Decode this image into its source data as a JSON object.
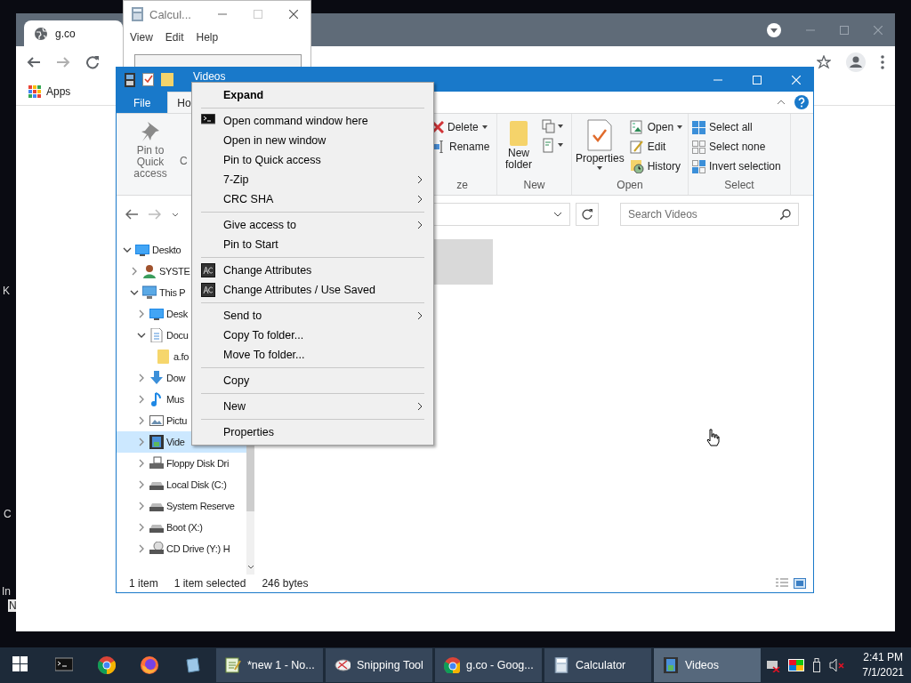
{
  "desktop": {
    "edge_texts": [
      "K",
      "C",
      "In",
      "N"
    ]
  },
  "browser": {
    "tab_title": "g.co",
    "bookmarks": [
      {
        "label": "Apps"
      }
    ]
  },
  "calculator": {
    "title": "Calcul...",
    "menu": [
      "View",
      "Edit",
      "Help"
    ]
  },
  "explorer": {
    "title": "Videos",
    "ribbon_tabs": [
      {
        "label": "File",
        "kind": "file",
        "selected": false
      },
      {
        "label": "Ho",
        "kind": "tab",
        "selected": true
      }
    ],
    "clipboard": {
      "pin_label": "Pin to Quick access",
      "copy_label": "C"
    },
    "organize": {
      "label": "ze",
      "delete": "Delete",
      "rename": "Rename"
    },
    "new": {
      "label": "New",
      "new_folder": "New folder"
    },
    "open": {
      "label": "Open",
      "properties": "Properties",
      "items": [
        {
          "label": "Open",
          "dropdown": true
        },
        {
          "label": "Edit",
          "dropdown": false
        },
        {
          "label": "History",
          "dropdown": false
        }
      ]
    },
    "select": {
      "label": "Select",
      "items": [
        "Select all",
        "Select none",
        "Invert selection"
      ]
    },
    "search": {
      "placeholder": "Search Videos"
    },
    "tree": [
      {
        "label": "Deskto",
        "kind": "desktop",
        "expanded": true,
        "selected": false,
        "children": [
          {
            "label": "SYSTE",
            "kind": "user",
            "expanded": false,
            "selected": false
          },
          {
            "label": "This P",
            "kind": "pc",
            "expanded": true,
            "selected": false,
            "children": [
              {
                "label": "Desk",
                "kind": "desktop",
                "expanded": false,
                "selected": false
              },
              {
                "label": "Docu",
                "kind": "documents",
                "expanded": true,
                "selected": false,
                "children": [
                  {
                    "label": "a.fo",
                    "kind": "folder",
                    "selected": false
                  }
                ]
              },
              {
                "label": "Dow",
                "kind": "downloads",
                "expanded": false,
                "selected": false
              },
              {
                "label": "Mus",
                "kind": "music",
                "expanded": false,
                "selected": false
              },
              {
                "label": "Pictu",
                "kind": "pictures",
                "expanded": false,
                "selected": false
              },
              {
                "label": "Vide",
                "kind": "videos",
                "expanded": false,
                "selected": true
              },
              {
                "label": "Floppy Disk Dri",
                "kind": "floppy",
                "expanded": false,
                "selected": false
              },
              {
                "label": "Local Disk (C:)",
                "kind": "drive",
                "expanded": false,
                "selected": false
              },
              {
                "label": "System Reserve",
                "kind": "drive",
                "expanded": false,
                "selected": false
              },
              {
                "label": "Boot (X:)",
                "kind": "drive",
                "expanded": false,
                "selected": false
              },
              {
                "label": "CD Drive (Y:) H",
                "kind": "cdrom",
                "expanded": false,
                "selected": false
              }
            ]
          }
        ]
      }
    ],
    "status": {
      "count": "1 item",
      "selection": "1 item selected",
      "size": "246 bytes"
    }
  },
  "context_menu": {
    "groups": [
      [
        {
          "label": "Expand",
          "kind": "text",
          "default": true,
          "submenu": false
        }
      ],
      [
        {
          "label": "Open command window here",
          "kind": "cmd",
          "submenu": false
        },
        {
          "label": "Open in new window",
          "kind": "text",
          "submenu": false
        },
        {
          "label": "Pin to Quick access",
          "kind": "text",
          "submenu": false
        },
        {
          "label": "7-Zip",
          "kind": "text",
          "submenu": true
        },
        {
          "label": "CRC SHA",
          "kind": "text",
          "submenu": true
        }
      ],
      [
        {
          "label": "Give access to",
          "kind": "text",
          "submenu": true
        },
        {
          "label": "Pin to Start",
          "kind": "text",
          "submenu": false
        }
      ],
      [
        {
          "label": "Change Attributes",
          "kind": "attrib",
          "submenu": false
        },
        {
          "label": "Change Attributes / Use Saved",
          "kind": "attrib",
          "submenu": false
        }
      ],
      [
        {
          "label": "Send to",
          "kind": "text",
          "submenu": true
        },
        {
          "label": "Copy To folder...",
          "kind": "text",
          "submenu": false
        },
        {
          "label": "Move To folder...",
          "kind": "text",
          "submenu": false
        }
      ],
      [
        {
          "label": "Copy",
          "kind": "text",
          "submenu": false
        }
      ],
      [
        {
          "label": "New",
          "kind": "text",
          "submenu": true
        }
      ],
      [
        {
          "label": "Properties",
          "kind": "text",
          "submenu": false
        }
      ]
    ]
  },
  "taskbar": {
    "pinned": [
      {
        "kind": "start"
      },
      {
        "kind": "terminal"
      },
      {
        "kind": "chrome"
      },
      {
        "kind": "firefox"
      },
      {
        "kind": "app"
      }
    ],
    "windows": [
      {
        "label": "*new 1 - No...",
        "kind": "notepad",
        "selected": false
      },
      {
        "label": "Snipping Tool",
        "kind": "snip",
        "selected": false
      },
      {
        "label": "g.co - Goog...",
        "kind": "chrome",
        "selected": false
      },
      {
        "label": "Calculator",
        "kind": "calc",
        "selected": false
      },
      {
        "label": "Videos",
        "kind": "videos",
        "selected": true
      }
    ],
    "clock": {
      "time": "2:41 PM",
      "date": "7/1/2021"
    }
  }
}
